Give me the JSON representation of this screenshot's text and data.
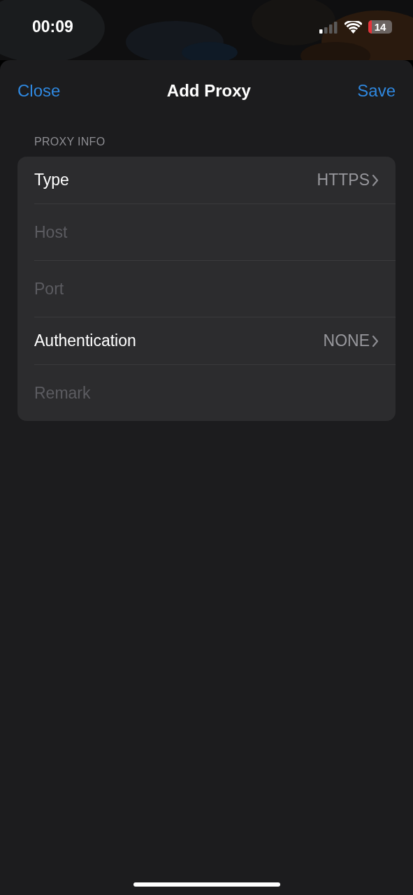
{
  "status_bar": {
    "time": "00:09",
    "battery": "14"
  },
  "nav_bar": {
    "left": "Close",
    "title": "Add Proxy",
    "right": "Save"
  },
  "section": {
    "header": "PROXY INFO",
    "rows": [
      {
        "kind": "picker",
        "label": "Type",
        "value": "HTTPS"
      },
      {
        "kind": "field",
        "placeholder": "Host"
      },
      {
        "kind": "field",
        "placeholder": "Port"
      },
      {
        "kind": "picker",
        "label": "Authentication",
        "value": "NONE"
      },
      {
        "kind": "field",
        "placeholder": "Remark"
      }
    ]
  }
}
